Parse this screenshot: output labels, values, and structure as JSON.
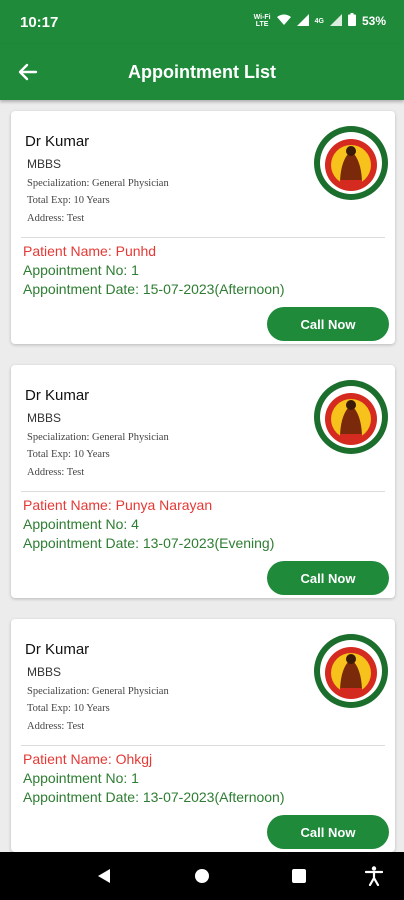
{
  "status_bar": {
    "time": "10:17",
    "net_label_top": "Wi-Fi",
    "net_label_bottom": "LTE",
    "net_4g": "4G",
    "battery": "53%"
  },
  "header": {
    "title": "Appointment List"
  },
  "colors": {
    "primary": "#1e8a3a",
    "patient_name": "#e53935",
    "appointment_text": "#2e7d32"
  },
  "appointments": [
    {
      "doctor_name": "Dr Kumar",
      "degree": "MBBS",
      "specialization": "Specialization: General Physician",
      "experience": "Total Exp: 10 Years",
      "address": "Address: Test",
      "patient_name": "Patient Name: Punhd",
      "appointment_no": "Appointment No: 1",
      "appointment_date": "Appointment Date: 15-07-2023(Afternoon)",
      "call_label": "Call Now"
    },
    {
      "doctor_name": "Dr Kumar",
      "degree": "MBBS",
      "specialization": "Specialization: General Physician",
      "experience": "Total Exp: 10 Years",
      "address": "Address: Test",
      "patient_name": "Patient Name: Punya Narayan",
      "appointment_no": "Appointment No: 4",
      "appointment_date": "Appointment Date: 13-07-2023(Evening)",
      "call_label": "Call Now"
    },
    {
      "doctor_name": "Dr Kumar",
      "degree": "MBBS",
      "specialization": "Specialization: General Physician",
      "experience": "Total Exp: 10 Years",
      "address": "Address: Test",
      "patient_name": "Patient Name: Ohkgj",
      "appointment_no": "Appointment No: 1",
      "appointment_date": "Appointment Date: 13-07-2023(Afternoon)",
      "call_label": "Call Now"
    }
  ],
  "nav": {
    "back_icon": "triangle-back-icon",
    "home_icon": "circle-home-icon",
    "recents_icon": "square-recents-icon",
    "accessibility_icon": "accessibility-icon"
  }
}
